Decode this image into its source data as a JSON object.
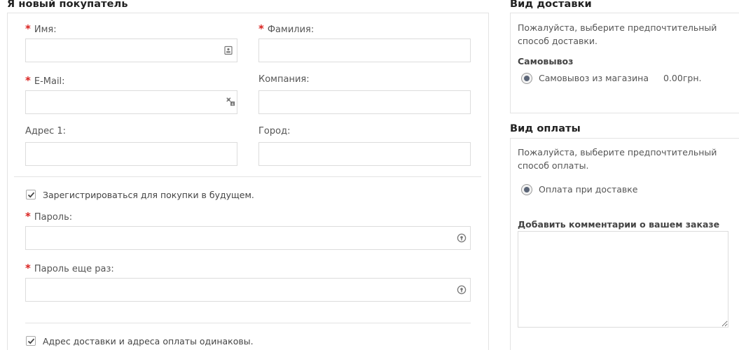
{
  "new_customer": {
    "title": "Я новый покупатель",
    "first_name_label": "Имя:",
    "last_name_label": "Фамилия:",
    "email_label": "E-Mail:",
    "company_label": "Компания:",
    "address_label": "Адрес 1:",
    "city_label": "Город:",
    "required_mark": "*",
    "register_label": "Зарегистрироваться для покупки в будущем.",
    "register_checked": true,
    "password_label": "Пароль:",
    "password_confirm_label": "Пароль еще раз:",
    "same_address_label": "Адрес доставки и адреса оплаты одинаковы.",
    "same_address_checked": true
  },
  "shipping": {
    "title": "Вид доставки",
    "instruction": "Пожалуйста, выберите предпочтительный способ доставки.",
    "method_group": "Самовывоз",
    "option_label": "Самовывоз из магазина",
    "option_price": "0.00грн.",
    "option_selected": true
  },
  "payment": {
    "title": "Вид оплаты",
    "instruction": "Пожалуйста, выберите предпочтительный способ оплаты.",
    "option_label": "Оплата при доставке",
    "option_selected": true,
    "comment_label": "Добавить комментарии о вашем заказе",
    "comment_value": ""
  },
  "icons": {
    "contact_card": "contact-card-icon",
    "key_autofill": "key-autofill-icon",
    "password_reveal": "password-manager-icon"
  }
}
